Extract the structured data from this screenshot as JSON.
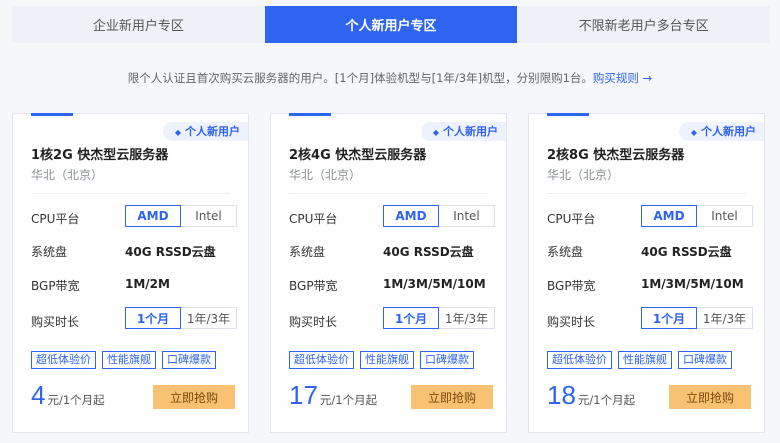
{
  "tabs": [
    {
      "label": "企业新用户专区",
      "active": false
    },
    {
      "label": "个人新用户专区",
      "active": true
    },
    {
      "label": "不限新老用户多台专区",
      "active": false
    }
  ],
  "notice": {
    "text": "限个人认证且首次购买云服务器的用户。[1个月]体验机型与[1年/3年]机型，分别限购1台。",
    "link": "购买规则 →"
  },
  "cards": [
    {
      "badge": "个人新用户",
      "title": "1核2G 快杰型云服务器",
      "region": "华北（北京）",
      "cpu_label": "CPU平台",
      "cpu_options": [
        "AMD",
        "Intel"
      ],
      "disk_label": "系统盘",
      "disk_value": "40G RSSD云盘",
      "bw_label": "BGP带宽",
      "bw_value": "1M/2M",
      "term_label": "购买时长",
      "term_options": [
        "1个月",
        "1年/3年"
      ],
      "tags": [
        "超低体验价",
        "性能旗舰",
        "口碑爆款"
      ],
      "price": "4",
      "price_unit": "元/1个月起",
      "buy": "立即抢购"
    },
    {
      "badge": "个人新用户",
      "title": "2核4G 快杰型云服务器",
      "region": "华北（北京）",
      "cpu_label": "CPU平台",
      "cpu_options": [
        "AMD",
        "Intel"
      ],
      "disk_label": "系统盘",
      "disk_value": "40G RSSD云盘",
      "bw_label": "BGP带宽",
      "bw_value": "1M/3M/5M/10M",
      "term_label": "购买时长",
      "term_options": [
        "1个月",
        "1年/3年"
      ],
      "tags": [
        "超低体验价",
        "性能旗舰",
        "口碑爆款"
      ],
      "price": "17",
      "price_unit": "元/1个月起",
      "buy": "立即抢购"
    },
    {
      "badge": "个人新用户",
      "title": "2核8G 快杰型云服务器",
      "region": "华北（北京）",
      "cpu_label": "CPU平台",
      "cpu_options": [
        "AMD",
        "Intel"
      ],
      "disk_label": "系统盘",
      "disk_value": "40G RSSD云盘",
      "bw_label": "BGP带宽",
      "bw_value": "1M/3M/5M/10M",
      "term_label": "购买时长",
      "term_options": [
        "1个月",
        "1年/3年"
      ],
      "tags": [
        "超低体验价",
        "性能旗舰",
        "口碑爆款"
      ],
      "price": "18",
      "price_unit": "元/1个月起",
      "buy": "立即抢购"
    }
  ]
}
